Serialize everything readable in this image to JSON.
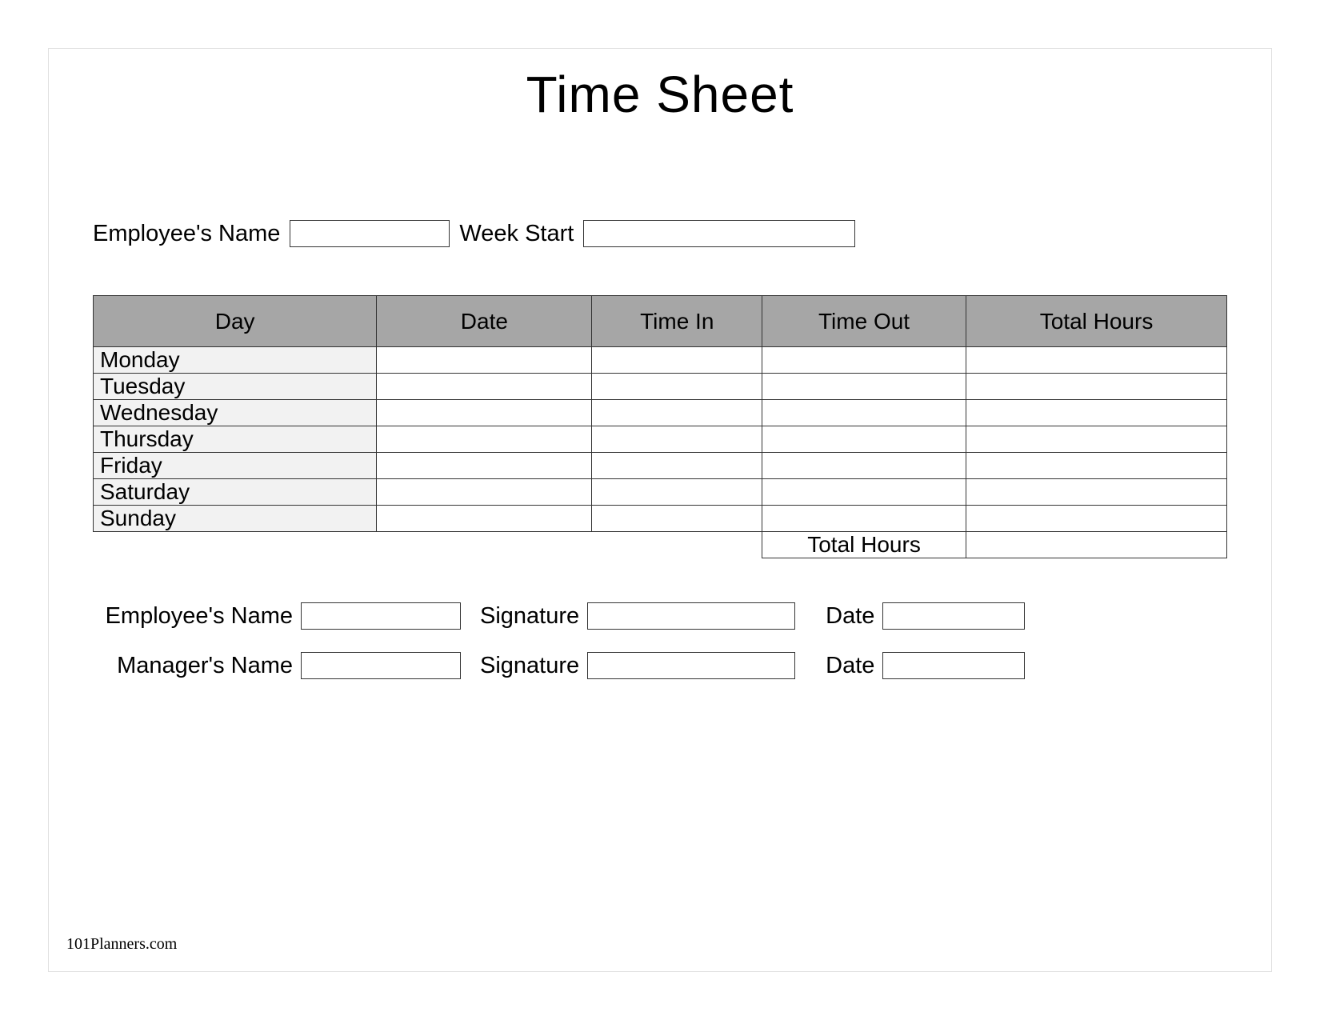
{
  "title": "Time Sheet",
  "header": {
    "employee_name_label": "Employee's Name",
    "employee_name_value": "",
    "week_start_label": "Week Start",
    "week_start_value": ""
  },
  "table": {
    "columns": [
      "Day",
      "Date",
      "Time In",
      "Time Out",
      "Total Hours"
    ],
    "rows": [
      {
        "day": "Monday",
        "date": "",
        "time_in": "",
        "time_out": "",
        "total": ""
      },
      {
        "day": "Tuesday",
        "date": "",
        "time_in": "",
        "time_out": "",
        "total": ""
      },
      {
        "day": "Wednesday",
        "date": "",
        "time_in": "",
        "time_out": "",
        "total": ""
      },
      {
        "day": "Thursday",
        "date": "",
        "time_in": "",
        "time_out": "",
        "total": ""
      },
      {
        "day": "Friday",
        "date": "",
        "time_in": "",
        "time_out": "",
        "total": ""
      },
      {
        "day": "Saturday",
        "date": "",
        "time_in": "",
        "time_out": "",
        "total": ""
      },
      {
        "day": "Sunday",
        "date": "",
        "time_in": "",
        "time_out": "",
        "total": ""
      }
    ],
    "total_label": "Total Hours",
    "total_value": ""
  },
  "signoff": {
    "employee": {
      "name_label": "Employee's Name",
      "name_value": "",
      "signature_label": "Signature",
      "signature_value": "",
      "date_label": "Date",
      "date_value": ""
    },
    "manager": {
      "name_label": "Manager's Name",
      "name_value": "",
      "signature_label": "Signature",
      "signature_value": "",
      "date_label": "Date",
      "date_value": ""
    }
  },
  "footer": "101Planners.com"
}
